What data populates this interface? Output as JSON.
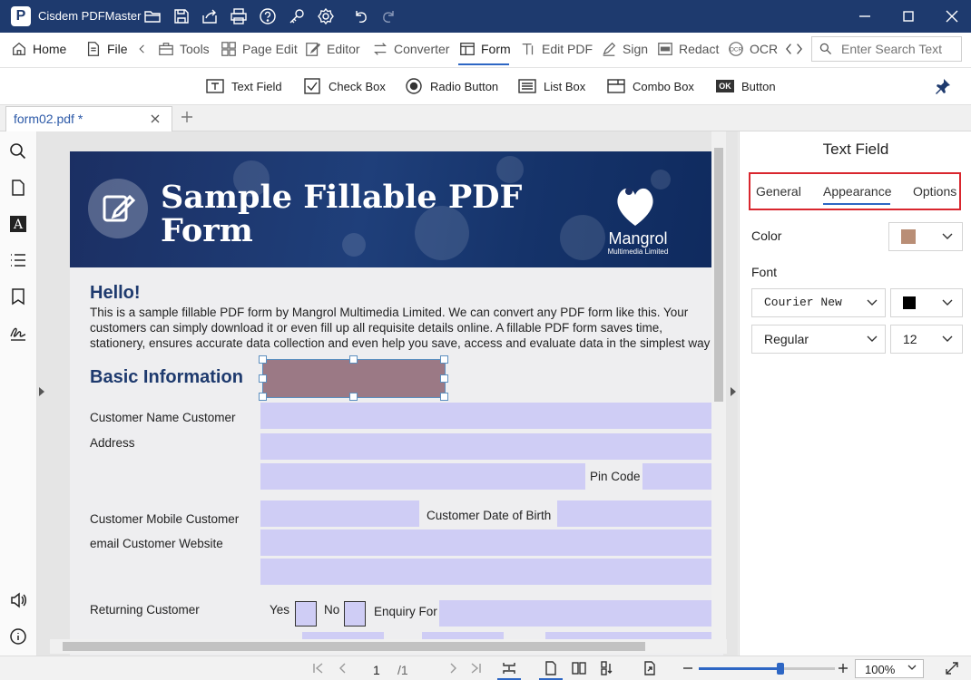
{
  "app": {
    "title": "Cisdem PDFMaster",
    "logo_letter": "P"
  },
  "menu": {
    "home": "Home",
    "file": "File",
    "tools": "Tools",
    "page_edit": "Page Edit",
    "editor": "Editor",
    "converter": "Converter",
    "form": "Form",
    "edit_pdf": "Edit PDF",
    "sign": "Sign",
    "redact": "Redact",
    "ocr": "OCR",
    "search_placeholder": "Enter Search Text"
  },
  "form_toolbar": {
    "text_field": "Text Field",
    "check_box": "Check Box",
    "radio_button": "Radio Button",
    "list_box": "List Box",
    "combo_box": "Combo Box",
    "button": "Button",
    "button_icon_text": "OK"
  },
  "tab": {
    "name": "form02.pdf *"
  },
  "document": {
    "title": "Sample Fillable PDF Form",
    "brand": "Mangrol",
    "brand_sub": "Multimedia Limited",
    "hello": "Hello!",
    "intro_lines": [
      "This is a sample fillable PDF form by Mangrol Multimedia Limited. We can convert any PDF form like this. Your",
      "customers can simply download it or even fill up all requisite details online. A fillable PDF form saves time,",
      "stationery, ensures accurate data collection and even help you save, access and evaluate data in the simplest way"
    ],
    "section": "Basic Information",
    "labels": {
      "customer_name": "Customer Name Customer",
      "address": "Address",
      "pin_code": "Pin Code",
      "customer_mobile": "Customer Mobile  Customer",
      "dob": "Customer Date of Birth",
      "email_website": "email Customer Website",
      "returning": "Returning Customer",
      "yes": "Yes",
      "no": "No",
      "enquiry": "Enquiry For"
    },
    "colors": {
      "selected_field": "#9b7985",
      "field": "#cfcdf5"
    }
  },
  "panel": {
    "title": "Text Field",
    "tabs": [
      "General",
      "Appearance",
      "Options"
    ],
    "active_tab": "Appearance",
    "color_label": "Color",
    "color_value": "#b98e76",
    "font_label": "Font",
    "font_family": "Courier New",
    "font_color": "#000000",
    "font_style": "Regular",
    "font_size": "12",
    "highlight_color": "#d9262e"
  },
  "status": {
    "current_page": "1",
    "total_pages": "/1",
    "zoom": "100%",
    "zoom_level": 0.6
  }
}
